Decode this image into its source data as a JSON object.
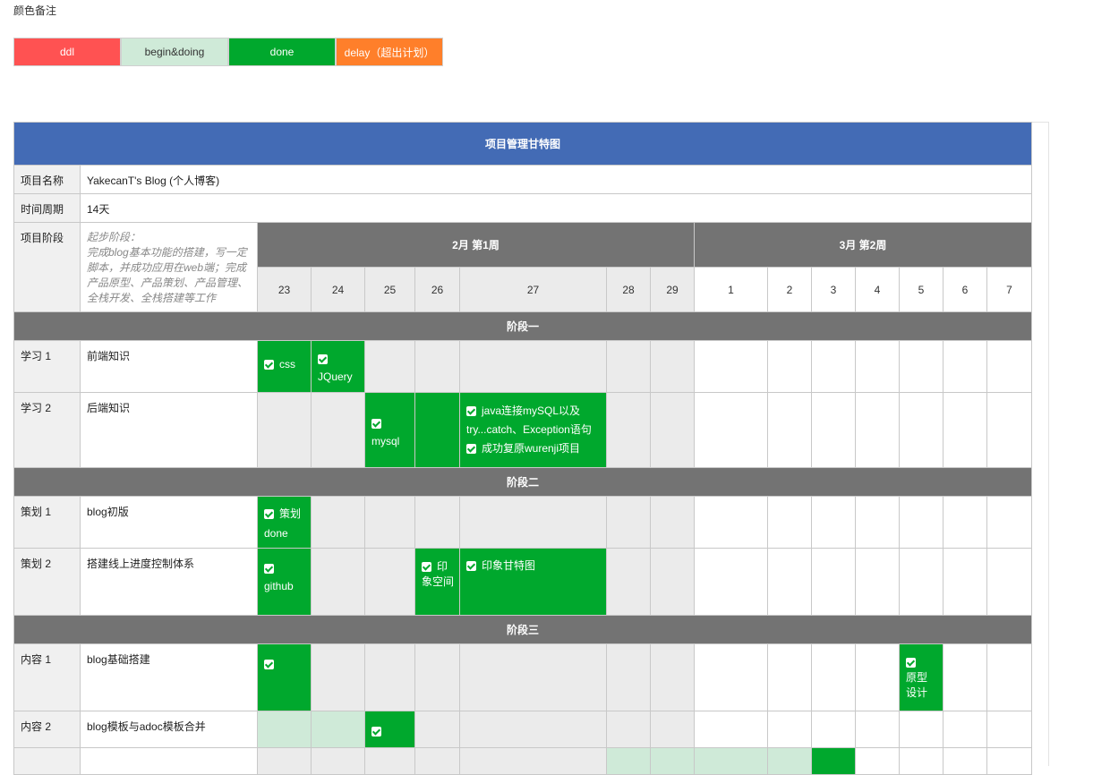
{
  "legend": {
    "title": "颜色备注",
    "items": [
      {
        "label": "ddl",
        "color": "#ff5252"
      },
      {
        "label": "begin&doing",
        "color": "#cfead8"
      },
      {
        "label": "done",
        "color": "#00a82d"
      },
      {
        "label": "delay（超出计划）",
        "color": "#ff7f2a"
      }
    ]
  },
  "gantt": {
    "title": "项目管理甘特图",
    "project_name_label": "项目名称",
    "project_name": "YakecanT's Blog (个人博客)",
    "period_label": "时间周期",
    "period": "14天",
    "phase_label": "项目阶段",
    "phase_desc": "起步阶段：\n完成blog基本功能的搭建，写一定脚本，并成功应用在web端；完成产品原型、产品策划、产品管理、全栈开发、全栈搭建等工作",
    "months": [
      "2月 第1周",
      "3月 第2周"
    ],
    "days": [
      "23",
      "24",
      "25",
      "26",
      "27",
      "28",
      "29",
      "1",
      "2",
      "3",
      "4",
      "5",
      "6",
      "7"
    ],
    "stages": [
      "阶段一",
      "阶段二",
      "阶段三"
    ],
    "rows": {
      "study1": {
        "label": "学习 1",
        "name": "前端知识",
        "t1": "css",
        "t2": "JQuery"
      },
      "study2": {
        "label": "学习 2",
        "name": "后端知识",
        "t1": "mysql",
        "t2a": "java连接mySQL以及try...catch、Exception语句",
        "t2b": "成功复原wurenji项目"
      },
      "plan1": {
        "label": "策划 1",
        "name": "blog初版",
        "t1": "策划done"
      },
      "plan2": {
        "label": "策划 2",
        "name": "搭建线上进度控制体系",
        "t1": "github",
        "t2": "印象空间",
        "t3": "印象甘特图"
      },
      "content1": {
        "label": "内容 1",
        "name": "blog基础搭建",
        "t2": "原型设计"
      },
      "content2": {
        "label": "内容 2",
        "name": "blog模板与adoc模板合并"
      }
    }
  },
  "colors": {
    "title_bar": "#436bb5",
    "header_gray": "#737373",
    "done": "#00a82d",
    "begin": "#cfead8"
  }
}
